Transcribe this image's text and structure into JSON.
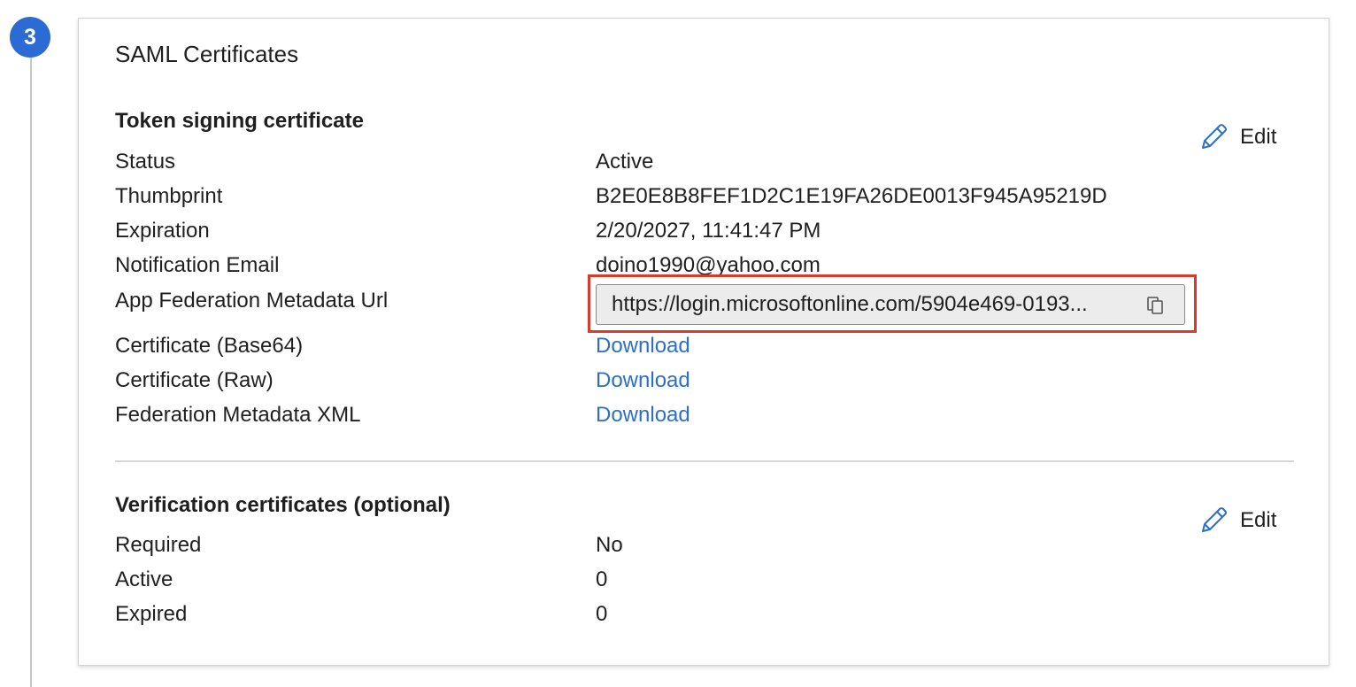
{
  "step": {
    "number": "3"
  },
  "card": {
    "title": "SAML Certificates"
  },
  "token_signing": {
    "title": "Token signing certificate",
    "edit_label": "Edit",
    "rows": [
      {
        "label": "Status",
        "value": "Active"
      },
      {
        "label": "Thumbprint",
        "value": "B2E0E8B8FEF1D2C1E19FA26DE0013F945A95219D"
      },
      {
        "label": "Expiration",
        "value": "2/20/2027, 11:41:47 PM"
      },
      {
        "label": "Notification Email",
        "value": "doino1990@yahoo.com"
      }
    ],
    "metadata_url": {
      "label": "App Federation Metadata Url",
      "value": "https://login.microsoftonline.com/5904e469-0193..."
    },
    "downloads": [
      {
        "label": "Certificate (Base64)",
        "link": "Download"
      },
      {
        "label": "Certificate (Raw)",
        "link": "Download"
      },
      {
        "label": "Federation Metadata XML",
        "link": "Download"
      }
    ]
  },
  "verification": {
    "title": "Verification certificates (optional)",
    "edit_label": "Edit",
    "rows": [
      {
        "label": "Required",
        "value": "No"
      },
      {
        "label": "Active",
        "value": "0"
      },
      {
        "label": "Expired",
        "value": "0"
      }
    ]
  },
  "icons": {
    "edit": "pencil-icon",
    "copy": "copy-icon"
  },
  "colors": {
    "step_badge": "#2c6bd4",
    "link": "#2b6fc9",
    "highlight": "#d93a2b",
    "edit_icon": "#2b6fc9"
  }
}
